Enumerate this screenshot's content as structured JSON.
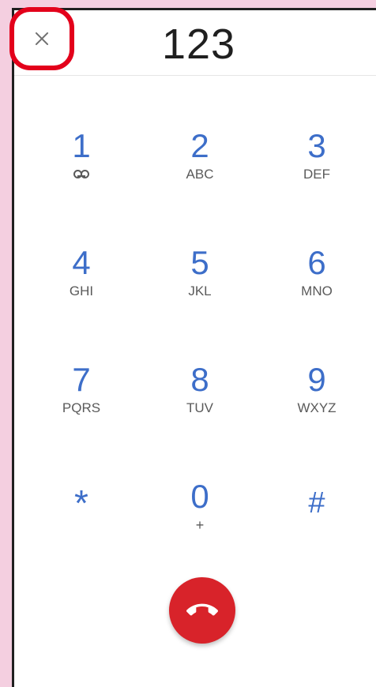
{
  "header": {
    "digits": "123"
  },
  "keypad": {
    "keys": [
      {
        "digit": "1",
        "letters": ""
      },
      {
        "digit": "2",
        "letters": "ABC"
      },
      {
        "digit": "3",
        "letters": "DEF"
      },
      {
        "digit": "4",
        "letters": "GHI"
      },
      {
        "digit": "5",
        "letters": "JKL"
      },
      {
        "digit": "6",
        "letters": "MNO"
      },
      {
        "digit": "7",
        "letters": "PQRS"
      },
      {
        "digit": "8",
        "letters": "TUV"
      },
      {
        "digit": "9",
        "letters": "WXYZ"
      },
      {
        "digit": "*",
        "letters": ""
      },
      {
        "digit": "0",
        "letters": "+"
      },
      {
        "digit": "#",
        "letters": ""
      }
    ]
  },
  "colors": {
    "accent_blue": "#3d6ec9",
    "end_call_red": "#d8232a",
    "highlight_red": "#e3001b",
    "background_pink": "#f4cfe0"
  },
  "icons": {
    "close": "close-icon",
    "voicemail": "voicemail-icon",
    "end_call": "end-call-icon"
  }
}
